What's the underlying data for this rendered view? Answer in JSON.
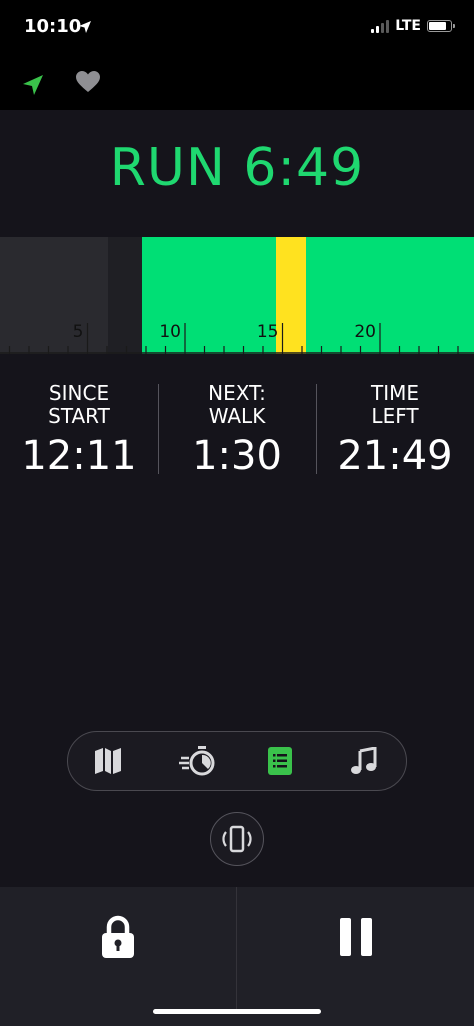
{
  "status_bar": {
    "time": "10:10",
    "network": "LTE"
  },
  "header": {
    "location_icon": "location-arrow-icon",
    "favorite_icon": "heart-icon",
    "accent_color": "#1fd870"
  },
  "run": {
    "title": "RUN 6:49"
  },
  "timeline": {
    "tick_labels": [
      "5",
      "10",
      "15",
      "20"
    ],
    "colors": {
      "walk": "#2a2a2f",
      "past": "#1f1f24",
      "run": "#00df75",
      "marker": "#ffe21f"
    }
  },
  "stats": [
    {
      "label_line1": "SINCE",
      "label_line2": "START",
      "value": "12:11"
    },
    {
      "label_line1": "NEXT:",
      "label_line2": "WALK",
      "value": "1:30"
    },
    {
      "label_line1": "TIME",
      "label_line2": "LEFT",
      "value": "21:49"
    }
  ],
  "tabs": [
    {
      "name": "map",
      "icon": "map-icon",
      "active": false
    },
    {
      "name": "stopwatch",
      "icon": "stopwatch-icon",
      "active": false
    },
    {
      "name": "list",
      "icon": "list-icon",
      "active": true
    },
    {
      "name": "music",
      "icon": "music-note-icon",
      "active": false
    }
  ],
  "controls": {
    "rotate_icon": "screen-rotation-icon",
    "lock_icon": "lock-icon",
    "pause_icon": "pause-icon"
  }
}
